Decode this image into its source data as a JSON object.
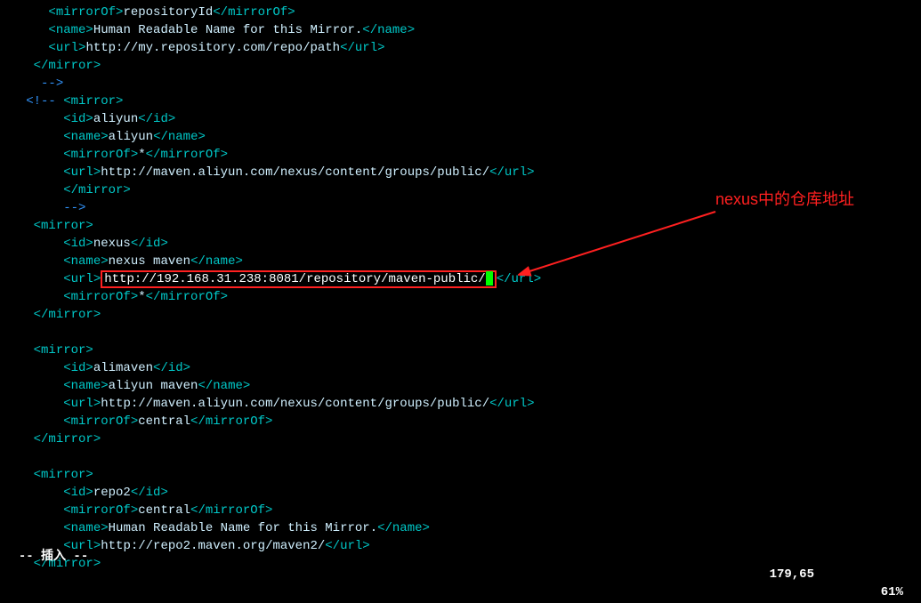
{
  "lines": [
    {
      "indent": 6,
      "parts": [
        {
          "cls": "t-tag",
          "t": "<mirrorOf>"
        },
        {
          "cls": "t-text",
          "t": "repositoryId"
        },
        {
          "cls": "t-tag",
          "t": "</mirrorOf>"
        }
      ]
    },
    {
      "indent": 6,
      "parts": [
        {
          "cls": "t-tag",
          "t": "<name>"
        },
        {
          "cls": "t-text",
          "t": "Human Readable Name for this Mirror."
        },
        {
          "cls": "t-tag",
          "t": "</name>"
        }
      ]
    },
    {
      "indent": 6,
      "parts": [
        {
          "cls": "t-tag",
          "t": "<url>"
        },
        {
          "cls": "t-text",
          "t": "http://my.repository.com/repo/path"
        },
        {
          "cls": "t-tag",
          "t": "</url>"
        }
      ]
    },
    {
      "indent": 4,
      "parts": [
        {
          "cls": "t-tag",
          "t": "</mirror>"
        }
      ]
    },
    {
      "indent": 5,
      "parts": [
        {
          "cls": "t-cmt",
          "t": "-->"
        }
      ]
    },
    {
      "indent": 3,
      "parts": [
        {
          "cls": "t-cmt",
          "t": "<!-- "
        },
        {
          "cls": "t-tag",
          "t": "<mirror>"
        }
      ]
    },
    {
      "indent": 8,
      "parts": [
        {
          "cls": "t-tag",
          "t": "<id>"
        },
        {
          "cls": "t-text",
          "t": "aliyun"
        },
        {
          "cls": "t-tag",
          "t": "</id>"
        }
      ]
    },
    {
      "indent": 8,
      "parts": [
        {
          "cls": "t-tag",
          "t": "<name>"
        },
        {
          "cls": "t-text",
          "t": "aliyun"
        },
        {
          "cls": "t-tag",
          "t": "</name>"
        }
      ]
    },
    {
      "indent": 8,
      "parts": [
        {
          "cls": "t-tag",
          "t": "<mirrorOf>"
        },
        {
          "cls": "t-text",
          "t": "*"
        },
        {
          "cls": "t-tag",
          "t": "</mirrorOf>"
        }
      ]
    },
    {
      "indent": 8,
      "parts": [
        {
          "cls": "t-tag",
          "t": "<url>"
        },
        {
          "cls": "t-text",
          "t": "http://maven.aliyun.com/nexus/content/groups/public/"
        },
        {
          "cls": "t-tag",
          "t": "</url>"
        }
      ]
    },
    {
      "indent": 8,
      "parts": [
        {
          "cls": "t-tag",
          "t": "</mirror>"
        }
      ]
    },
    {
      "indent": 8,
      "parts": [
        {
          "cls": "t-cmt",
          "t": "-->"
        }
      ]
    },
    {
      "indent": 4,
      "parts": [
        {
          "cls": "t-tag",
          "t": "<mirror>"
        }
      ]
    },
    {
      "indent": 8,
      "parts": [
        {
          "cls": "t-tag",
          "t": "<id>"
        },
        {
          "cls": "t-text",
          "t": "nexus"
        },
        {
          "cls": "t-tag",
          "t": "</id>"
        }
      ]
    },
    {
      "indent": 8,
      "parts": [
        {
          "cls": "t-tag",
          "t": "<name>"
        },
        {
          "cls": "t-text",
          "t": "nexus maven"
        },
        {
          "cls": "t-tag",
          "t": "</name>"
        }
      ]
    },
    {
      "indent": 8,
      "highlight": true,
      "parts": [
        {
          "cls": "t-tag",
          "t": "<url>"
        },
        {
          "cls": "hlbox",
          "inner": [
            {
              "cls": "t-text",
              "t": "http://192.168.31.238:8081/repository/maven-public/"
            },
            {
              "cls": "cursor",
              "t": ""
            }
          ]
        },
        {
          "cls": "t-tag",
          "t": "</url>"
        }
      ]
    },
    {
      "indent": 8,
      "parts": [
        {
          "cls": "t-tag",
          "t": "<mirrorOf>"
        },
        {
          "cls": "t-text",
          "t": "*"
        },
        {
          "cls": "t-tag",
          "t": "</mirrorOf>"
        }
      ]
    },
    {
      "indent": 4,
      "parts": [
        {
          "cls": "t-tag",
          "t": "</mirror>"
        }
      ]
    },
    {
      "indent": 0,
      "parts": []
    },
    {
      "indent": 4,
      "parts": [
        {
          "cls": "t-tag",
          "t": "<mirror>"
        }
      ]
    },
    {
      "indent": 8,
      "parts": [
        {
          "cls": "t-tag",
          "t": "<id>"
        },
        {
          "cls": "t-text",
          "t": "alimaven"
        },
        {
          "cls": "t-tag",
          "t": "</id>"
        }
      ]
    },
    {
      "indent": 8,
      "parts": [
        {
          "cls": "t-tag",
          "t": "<name>"
        },
        {
          "cls": "t-text",
          "t": "aliyun maven"
        },
        {
          "cls": "t-tag",
          "t": "</name>"
        }
      ]
    },
    {
      "indent": 8,
      "parts": [
        {
          "cls": "t-tag",
          "t": "<url>"
        },
        {
          "cls": "t-text",
          "t": "http://maven.aliyun.com/nexus/content/groups/public/"
        },
        {
          "cls": "t-tag",
          "t": "</url>"
        }
      ]
    },
    {
      "indent": 8,
      "parts": [
        {
          "cls": "t-tag",
          "t": "<mirrorOf>"
        },
        {
          "cls": "t-text",
          "t": "central"
        },
        {
          "cls": "t-tag",
          "t": "</mirrorOf>"
        }
      ]
    },
    {
      "indent": 4,
      "parts": [
        {
          "cls": "t-tag",
          "t": "</mirror>"
        }
      ]
    },
    {
      "indent": 0,
      "parts": []
    },
    {
      "indent": 4,
      "parts": [
        {
          "cls": "t-tag",
          "t": "<mirror>"
        }
      ]
    },
    {
      "indent": 8,
      "parts": [
        {
          "cls": "t-tag",
          "t": "<id>"
        },
        {
          "cls": "t-text",
          "t": "repo2"
        },
        {
          "cls": "t-tag",
          "t": "</id>"
        }
      ]
    },
    {
      "indent": 8,
      "parts": [
        {
          "cls": "t-tag",
          "t": "<mirrorOf>"
        },
        {
          "cls": "t-text",
          "t": "central"
        },
        {
          "cls": "t-tag",
          "t": "</mirrorOf>"
        }
      ]
    },
    {
      "indent": 8,
      "parts": [
        {
          "cls": "t-tag",
          "t": "<name>"
        },
        {
          "cls": "t-text",
          "t": "Human Readable Name for this Mirror."
        },
        {
          "cls": "t-tag",
          "t": "</name>"
        }
      ]
    },
    {
      "indent": 8,
      "parts": [
        {
          "cls": "t-tag",
          "t": "<url>"
        },
        {
          "cls": "t-text",
          "t": "http://repo2.maven.org/maven2/"
        },
        {
          "cls": "t-tag",
          "t": "</url>"
        }
      ]
    },
    {
      "indent": 4,
      "parts": [
        {
          "cls": "t-tag",
          "t": "</mirror>"
        }
      ]
    }
  ],
  "status": {
    "mode": "-- 插入 --",
    "pos": "179,65",
    "pct": "61%"
  },
  "annotation": {
    "label": "nexus中的仓库地址"
  }
}
